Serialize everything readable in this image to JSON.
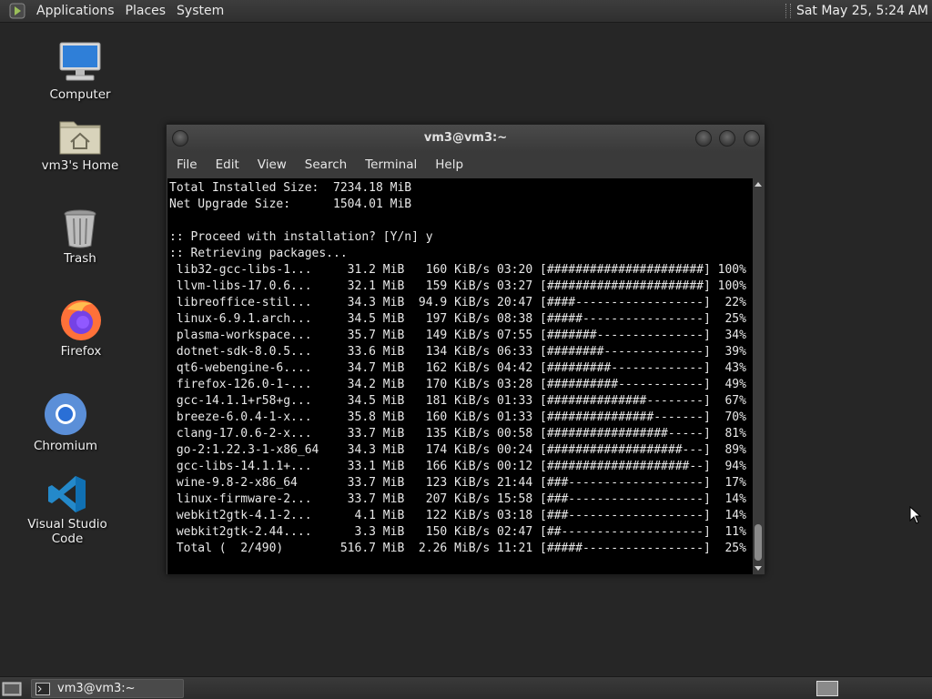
{
  "top_panel": {
    "menus": [
      "Applications",
      "Places",
      "System"
    ],
    "clock": "Sat May 25,  5:24 AM"
  },
  "desktop": {
    "icons": [
      {
        "label": "Computer",
        "icon": "computer-icon"
      },
      {
        "label": "vm3's Home",
        "icon": "home-folder-icon"
      },
      {
        "label": "Trash",
        "icon": "trash-icon"
      },
      {
        "label": "Firefox",
        "icon": "firefox-icon"
      },
      {
        "label": "Chromium",
        "icon": "chromium-icon"
      },
      {
        "label": "Visual Studio Code",
        "icon": "vscode-icon"
      }
    ]
  },
  "window": {
    "title": "vm3@vm3:~",
    "menus": [
      "File",
      "Edit",
      "View",
      "Search",
      "Terminal",
      "Help"
    ],
    "terminal_lines": [
      "Total Installed Size:  7234.18 MiB",
      "Net Upgrade Size:      1504.01 MiB",
      "",
      ":: Proceed with installation? [Y/n] y",
      ":: Retrieving packages...",
      " lib32-gcc-libs-1...     31.2 MiB   160 KiB/s 03:20 [######################] 100%",
      " llvm-libs-17.0.6...     32.1 MiB   159 KiB/s 03:27 [######################] 100%",
      " libreoffice-stil...     34.3 MiB  94.9 KiB/s 20:47 [####------------------]  22%",
      " linux-6.9.1.arch...     34.5 MiB   197 KiB/s 08:38 [#####-----------------]  25%",
      " plasma-workspace...     35.7 MiB   149 KiB/s 07:55 [#######---------------]  34%",
      " dotnet-sdk-8.0.5...     33.6 MiB   134 KiB/s 06:33 [########--------------]  39%",
      " qt6-webengine-6....     34.7 MiB   162 KiB/s 04:42 [#########-------------]  43%",
      " firefox-126.0-1-...     34.2 MiB   170 KiB/s 03:28 [##########------------]  49%",
      " gcc-14.1.1+r58+g...     34.5 MiB   181 KiB/s 01:33 [##############--------]  67%",
      " breeze-6.0.4-1-x...     35.8 MiB   160 KiB/s 01:33 [###############-------]  70%",
      " clang-17.0.6-2-x...     33.7 MiB   135 KiB/s 00:58 [#################-----]  81%",
      " go-2:1.22.3-1-x86_64    34.3 MiB   174 KiB/s 00:24 [###################---]  89%",
      " gcc-libs-14.1.1+...     33.1 MiB   166 KiB/s 00:12 [####################--]  94%",
      " wine-9.8-2-x86_64       33.7 MiB   123 KiB/s 21:44 [###-------------------]  17%",
      " linux-firmware-2...     33.7 MiB   207 KiB/s 15:58 [###-------------------]  14%",
      " webkit2gtk-4.1-2...      4.1 MiB   122 KiB/s 03:18 [###-------------------]  14%",
      " webkit2gtk-2.44....      3.3 MiB   150 KiB/s 02:47 [##--------------------]  11%",
      " Total (  2/490)        516.7 MiB  2.26 MiB/s 11:21 [#####-----------------]  25%"
    ]
  },
  "taskbar": {
    "task_label": "vm3@vm3:~"
  }
}
